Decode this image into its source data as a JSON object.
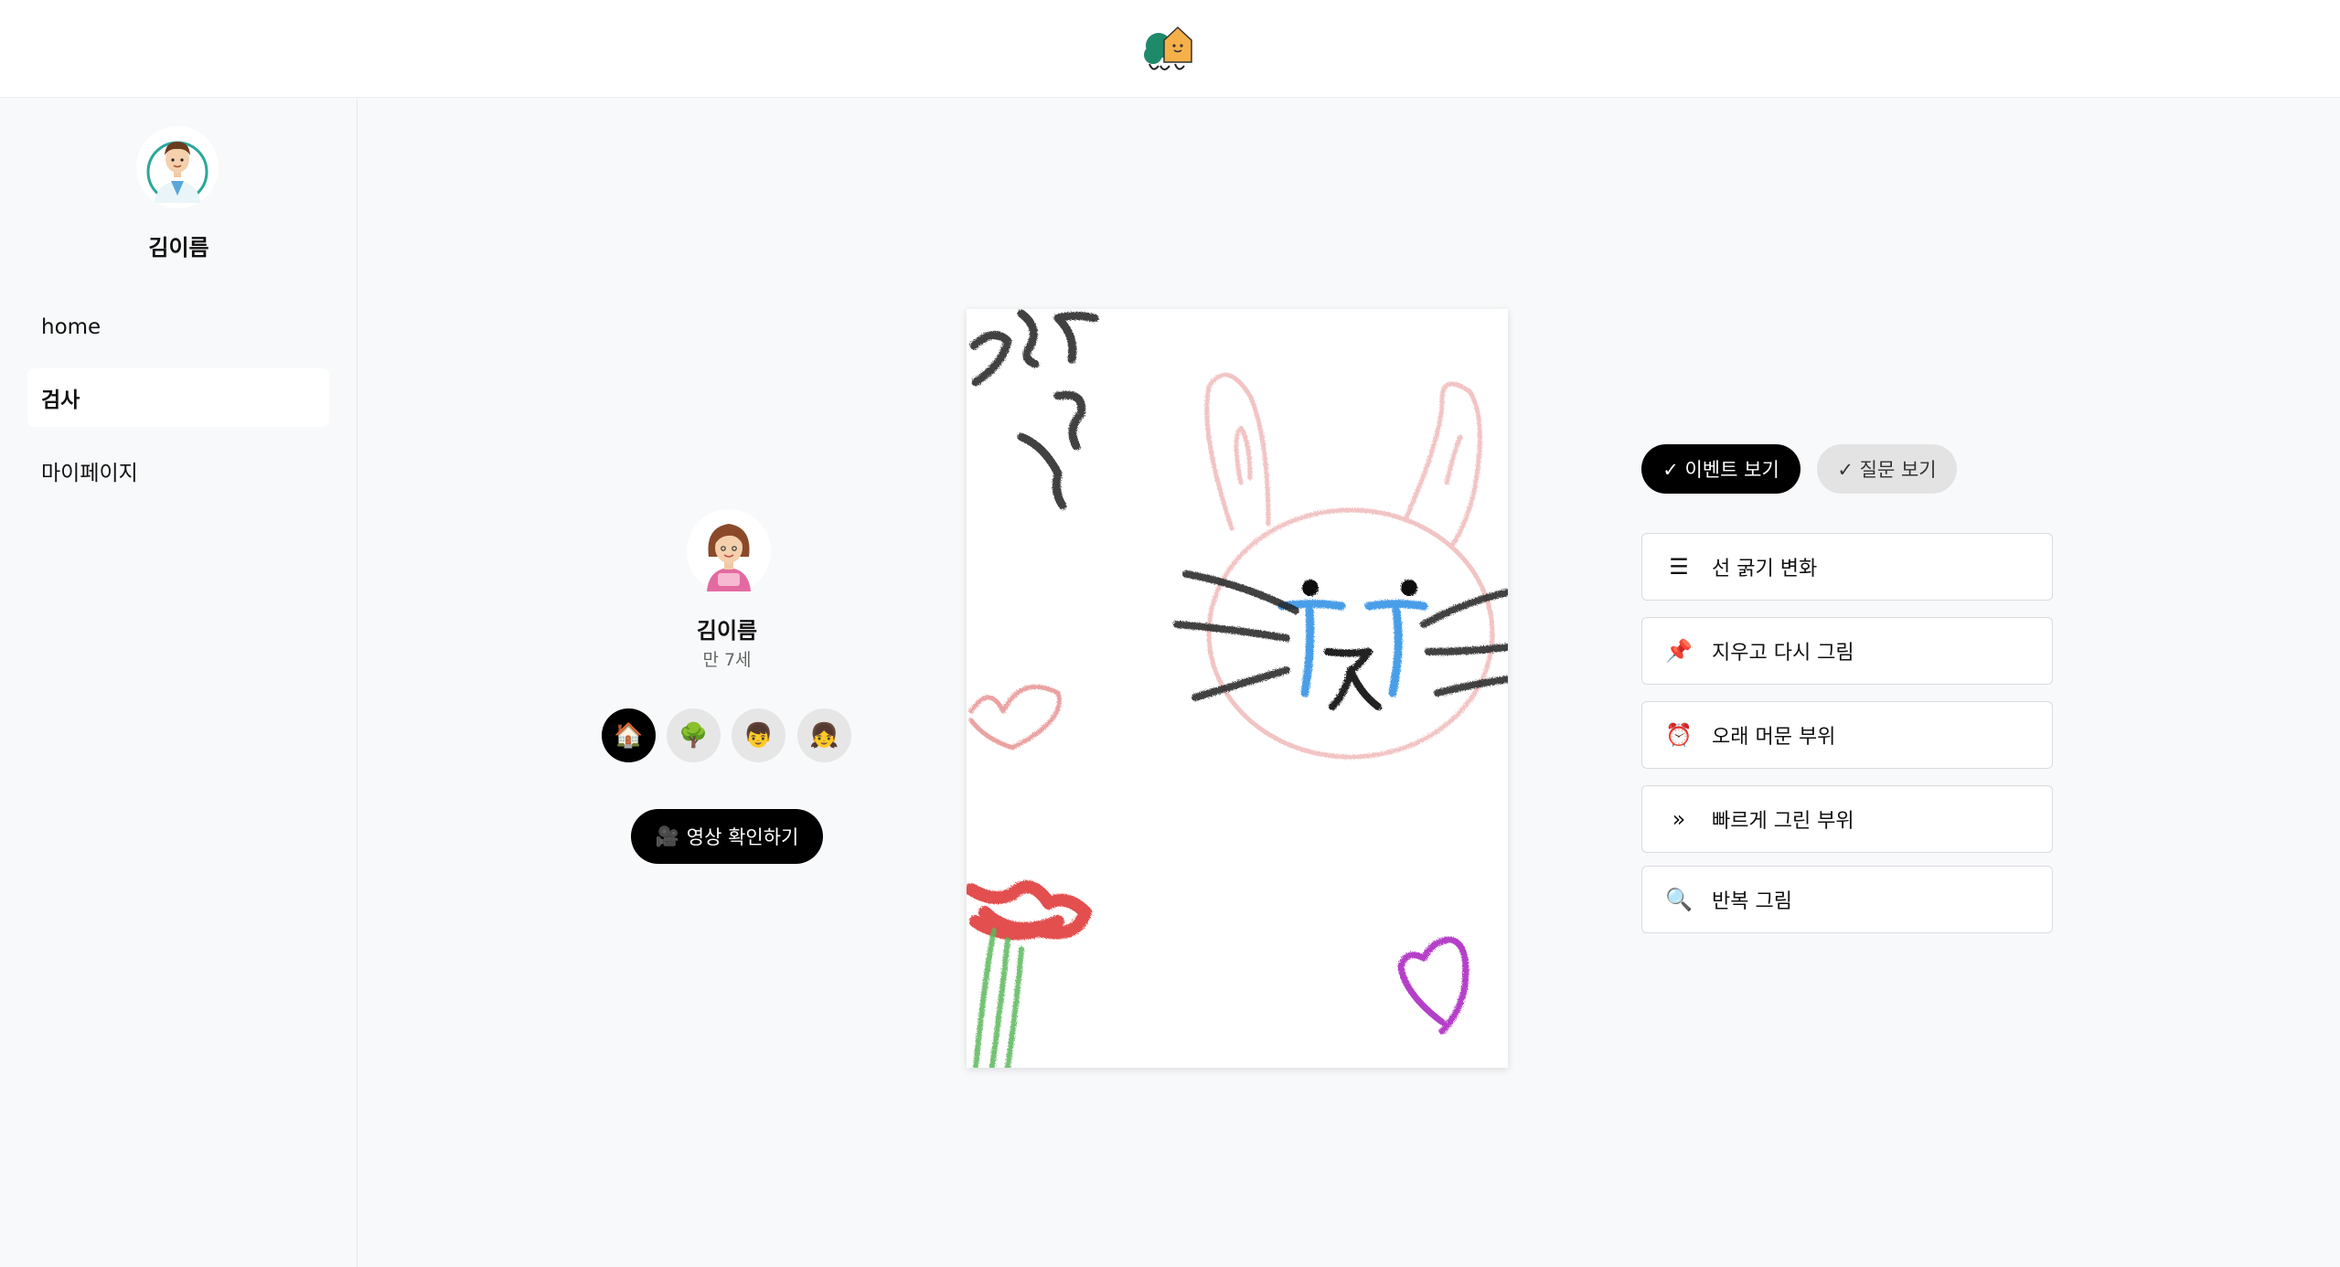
{
  "header": {
    "logo_icon": "forest-house-logo"
  },
  "sidebar": {
    "profile": {
      "name": "김이름",
      "avatar_icon": "doctor-avatar"
    },
    "nav": [
      {
        "label": "home",
        "active": false
      },
      {
        "label": "검사",
        "active": true
      },
      {
        "label": "마이페이지",
        "active": false
      }
    ]
  },
  "child": {
    "name": "김이름",
    "age": "만 7세",
    "avatar_icon": "girl-avatar",
    "categories": [
      {
        "icon": "house-icon",
        "glyph": "🏠",
        "active": true
      },
      {
        "icon": "tree-icon",
        "glyph": "🌳",
        "active": false
      },
      {
        "icon": "boy-icon",
        "glyph": "👦",
        "active": false
      },
      {
        "icon": "girl-icon",
        "glyph": "👧",
        "active": false
      }
    ],
    "video_button": {
      "icon": "movie-camera-icon",
      "glyph": "🎥",
      "label": "영상 확인하기"
    }
  },
  "drawing": {
    "subject": "crayon drawing",
    "colors": {
      "pink": "#f2c4c4",
      "blue": "#4a9ee8",
      "black": "#222222",
      "red": "#e03a3a",
      "green": "#5cb85c",
      "purple": "#b540c8"
    }
  },
  "toggles": {
    "events": "✓ 이벤트 보기",
    "questions": "✓ 질문 보기"
  },
  "tools": [
    {
      "icon": "lines-icon",
      "glyph": "☰",
      "label": "선 굵기 변화"
    },
    {
      "icon": "pushpin-icon",
      "glyph": "📌",
      "label": "지우고 다시 그림"
    },
    {
      "icon": "alarm-clock-icon",
      "glyph": "⏰",
      "label": "오래 머문 부위"
    },
    {
      "icon": "double-chevron-icon",
      "glyph": "»",
      "label": "빠르게 그린 부위"
    },
    {
      "icon": "magnifier-icon",
      "glyph": "🔍",
      "label": "반복 그림"
    }
  ]
}
